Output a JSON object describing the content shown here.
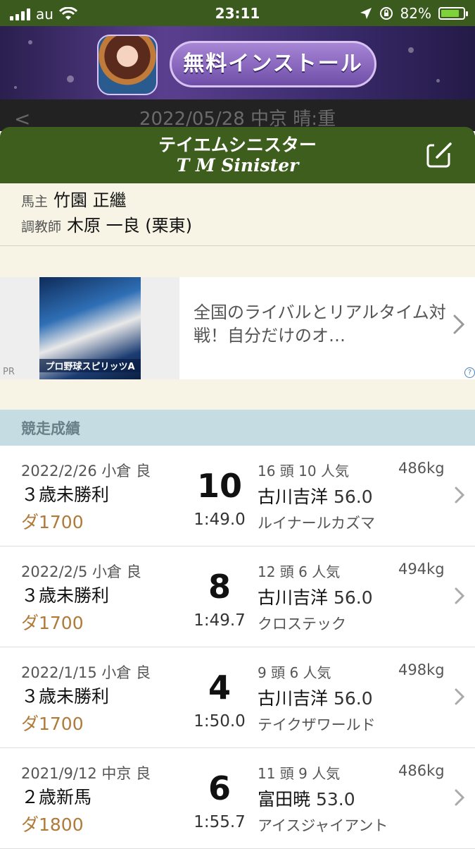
{
  "status_bar": {
    "carrier": "au",
    "time": "23:11",
    "battery": "82%",
    "battery_level": 0.82
  },
  "top_ad": {
    "button_label": "無料インストール"
  },
  "behind_header": {
    "text": "2022/05/28 中京 晴:重"
  },
  "header": {
    "title_jp": "テイエムシニスター",
    "title_en": "T M Sinister"
  },
  "info": {
    "owner_label": "馬主",
    "owner": "竹園 正繼",
    "trainer_label": "調教師",
    "trainer": "木原 一良 (栗東)"
  },
  "mid_ad": {
    "thumb_logo": "プロ野球スピリッツA",
    "pr_label": "PR",
    "text": "全国のライバルとリアルタイム対戦！自分だけのオ…",
    "help": "?"
  },
  "section": {
    "title": "競走成績"
  },
  "races": [
    {
      "date": "2022/2/26 小倉 良",
      "name": "３歳未勝利",
      "distance": "ダ1700",
      "position": "10",
      "time": "1:49.0",
      "field": "16 頭 10 人気",
      "weight": "486kg",
      "jockey": "古川吉洋",
      "kg": "56.0",
      "winner": "ルイナールカズマ"
    },
    {
      "date": "2022/2/5 小倉 良",
      "name": "３歳未勝利",
      "distance": "ダ1700",
      "position": "8",
      "time": "1:49.7",
      "field": "12 頭 6 人気",
      "weight": "494kg",
      "jockey": "古川吉洋",
      "kg": "56.0",
      "winner": "クロステック"
    },
    {
      "date": "2022/1/15 小倉 良",
      "name": "３歳未勝利",
      "distance": "ダ1700",
      "position": "4",
      "time": "1:50.0",
      "field": "9 頭 6 人気",
      "weight": "498kg",
      "jockey": "古川吉洋",
      "kg": "56.0",
      "winner": "テイクザワールド"
    },
    {
      "date": "2021/9/12 中京 良",
      "name": "２歳新馬",
      "distance": "ダ1800",
      "position": "6",
      "time": "1:55.7",
      "field": "11 頭 9 人気",
      "weight": "486kg",
      "jockey": "富田暁",
      "kg": "53.0",
      "winner": "アイスジャイアント"
    }
  ]
}
